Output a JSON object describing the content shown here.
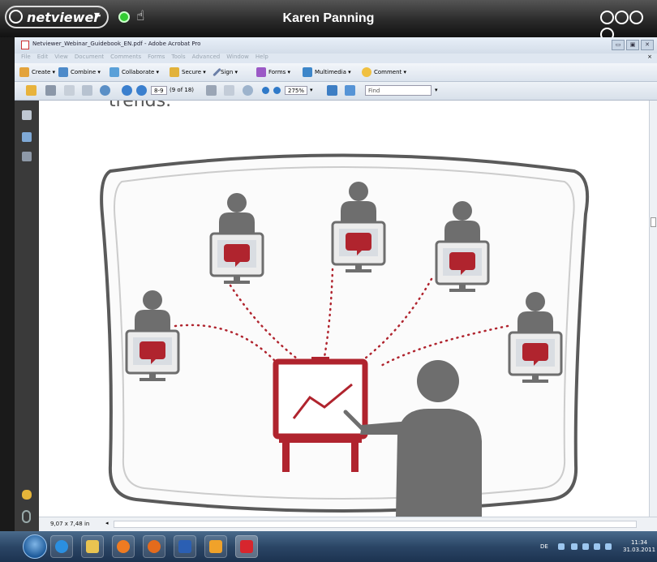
{
  "netviewer": {
    "logo": "netviewer",
    "user_name": "Karen Panning",
    "status_color": "#33cc33"
  },
  "acrobat": {
    "window_title": "Netviewer_Webinar_Guidebook_EN.pdf - Adobe Acrobat Pro",
    "menu": [
      "File",
      "Edit",
      "View",
      "Document",
      "Comments",
      "Forms",
      "Tools",
      "Advanced",
      "Window",
      "Help"
    ],
    "tasks": [
      {
        "label": "Create",
        "icon": "create-icon"
      },
      {
        "label": "Combine",
        "icon": "combine-icon"
      },
      {
        "label": "Collaborate",
        "icon": "collaborate-icon"
      },
      {
        "label": "Secure",
        "icon": "lock-icon"
      },
      {
        "label": "Sign",
        "icon": "pen-icon"
      },
      {
        "label": "Forms",
        "icon": "forms-icon"
      },
      {
        "label": "Multimedia",
        "icon": "multimedia-icon"
      },
      {
        "label": "Comment",
        "icon": "comment-icon"
      }
    ],
    "page_field": "8-9",
    "page_count": "(9 of 18)",
    "zoom": "275%",
    "find_placeholder": "Find",
    "page_size": "9,07 x 7,48 in",
    "doc_heading_fragment": "trends."
  },
  "taskbar": {
    "language": "DE",
    "time": "11:34",
    "date": "31.03.2011",
    "apps": [
      "ie-icon",
      "explorer-icon",
      "media-player-icon",
      "firefox-icon",
      "word-icon",
      "outlook-icon",
      "acrobat-icon"
    ]
  },
  "colors": {
    "accent_red": "#b0242e",
    "figure_gray": "#6e6e6e",
    "frame_gray": "#555555"
  }
}
